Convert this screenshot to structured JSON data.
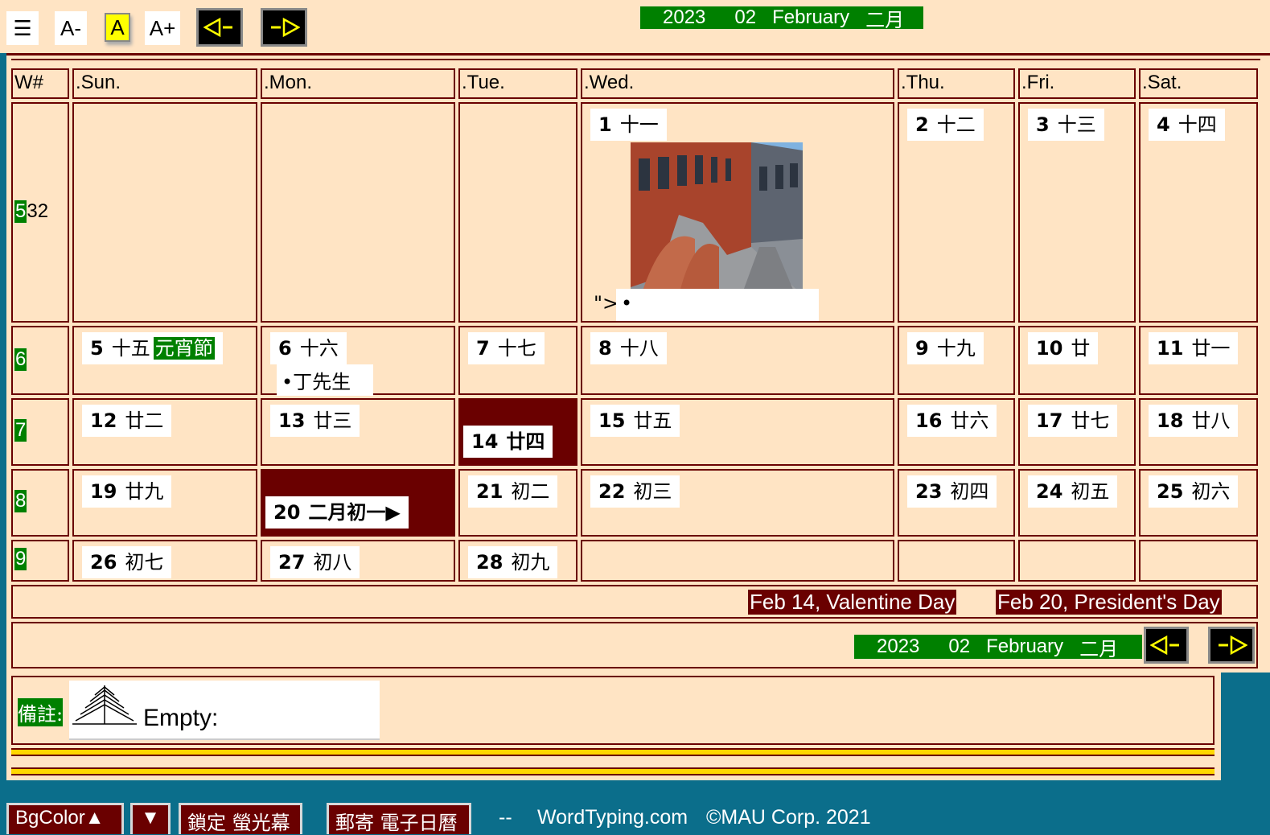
{
  "toolbar": {
    "menu_icon": "☰",
    "font_smaller": "A-",
    "font_normal": "A",
    "font_larger": "A+",
    "prev_icon": "prev-month-arrow",
    "next_icon": "next-month-arrow"
  },
  "title": {
    "year": "2023",
    "month_num": "02",
    "month_name": "February",
    "month_cn": "二月"
  },
  "headers": [
    "W#",
    ".Sun.",
    ".Mon.",
    ".Tue.",
    ".Wed.",
    ".Thu.",
    ".Fri.",
    ".Sat."
  ],
  "weeks": [
    {
      "week_of_month": "5",
      "week_number": "32"
    },
    {
      "week_of_month": "6",
      "week_number": ""
    },
    {
      "week_of_month": "7",
      "week_number": ""
    },
    {
      "week_of_month": "8",
      "week_number": ""
    },
    {
      "week_of_month": "9",
      "week_number": ""
    }
  ],
  "days": [
    {
      "day": "1",
      "lunar": "十一"
    },
    {
      "day": "2",
      "lunar": "十二"
    },
    {
      "day": "3",
      "lunar": "十三"
    },
    {
      "day": "4",
      "lunar": "十四"
    },
    {
      "day": "5",
      "lunar": "十五",
      "holiday": "元宵節"
    },
    {
      "day": "6",
      "lunar": "十六"
    },
    {
      "day": "7",
      "lunar": "十七"
    },
    {
      "day": "8",
      "lunar": "十八"
    },
    {
      "day": "9",
      "lunar": "十九"
    },
    {
      "day": "10",
      "lunar": "廿"
    },
    {
      "day": "11",
      "lunar": "廿一"
    },
    {
      "day": "12",
      "lunar": "廿二"
    },
    {
      "day": "13",
      "lunar": "廿三"
    },
    {
      "day": "14",
      "lunar": "廿四"
    },
    {
      "day": "15",
      "lunar": "廿五"
    },
    {
      "day": "16",
      "lunar": "廿六"
    },
    {
      "day": "17",
      "lunar": "廿七"
    },
    {
      "day": "18",
      "lunar": "廿八"
    },
    {
      "day": "19",
      "lunar": "廿九"
    },
    {
      "day": "20",
      "lunar": "二月初一▶"
    },
    {
      "day": "21",
      "lunar": "初二"
    },
    {
      "day": "22",
      "lunar": "初三"
    },
    {
      "day": "23",
      "lunar": "初四"
    },
    {
      "day": "24",
      "lunar": "初五"
    },
    {
      "day": "25",
      "lunar": "初六"
    },
    {
      "day": "26",
      "lunar": "初七"
    },
    {
      "day": "27",
      "lunar": "初八"
    },
    {
      "day": "28",
      "lunar": "初九"
    }
  ],
  "events": {
    "wed1_text": "\">",
    "wed1_bullet": "•",
    "mon6": "•丁先生"
  },
  "holiday_notes": [
    "Feb 14, Valentine Day",
    "Feb 20, President's Day"
  ],
  "notes": {
    "label": "備註:",
    "text": "Empty:"
  },
  "footer": {
    "bgcolor_up": "BgColor▲",
    "bgcolor_down": "▼",
    "lock_screen": "鎖定 螢光幕",
    "mail_calendar": "郵寄 電子日曆",
    "separator": "--",
    "site": "WordTyping.com",
    "copyright": "©MAU Corp. 2021"
  },
  "colors": {
    "panel": "#ffe4c4",
    "border": "#6a0000",
    "green": "#008000",
    "background": "#0b6e8b",
    "highlight": "#ffff00"
  }
}
